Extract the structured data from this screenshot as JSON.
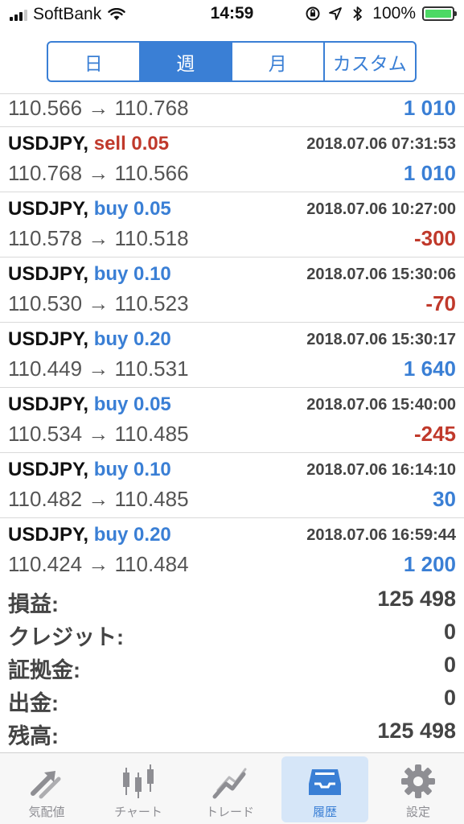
{
  "status_bar": {
    "carrier": "SoftBank",
    "time": "14:59",
    "battery": "100%",
    "battery_color": "#4cd964"
  },
  "segments": [
    {
      "label": "日",
      "active": false
    },
    {
      "label": "週",
      "active": true
    },
    {
      "label": "月",
      "active": false
    },
    {
      "label": "カスタム",
      "active": false
    }
  ],
  "partial_row": {
    "prices": "110.566 → 110.768",
    "pl": "1 010"
  },
  "trades": [
    {
      "symbol": "USDJPY,",
      "side": "sell",
      "lots": "sell 0.05",
      "datetime": "2018.07.06 07:31:53",
      "prices": "110.768 → 110.566",
      "pl": "1 010",
      "pl_sign": "pos"
    },
    {
      "symbol": "USDJPY,",
      "side": "buy",
      "lots": "buy 0.05",
      "datetime": "2018.07.06 10:27:00",
      "prices": "110.578 → 110.518",
      "pl": "-300",
      "pl_sign": "neg"
    },
    {
      "symbol": "USDJPY,",
      "side": "buy",
      "lots": "buy 0.10",
      "datetime": "2018.07.06 15:30:06",
      "prices": "110.530 → 110.523",
      "pl": "-70",
      "pl_sign": "neg"
    },
    {
      "symbol": "USDJPY,",
      "side": "buy",
      "lots": "buy 0.20",
      "datetime": "2018.07.06 15:30:17",
      "prices": "110.449 → 110.531",
      "pl": "1 640",
      "pl_sign": "pos"
    },
    {
      "symbol": "USDJPY,",
      "side": "buy",
      "lots": "buy 0.05",
      "datetime": "2018.07.06 15:40:00",
      "prices": "110.534 → 110.485",
      "pl": "-245",
      "pl_sign": "neg"
    },
    {
      "symbol": "USDJPY,",
      "side": "buy",
      "lots": "buy 0.10",
      "datetime": "2018.07.06 16:14:10",
      "prices": "110.482 → 110.485",
      "pl": "30",
      "pl_sign": "pos"
    },
    {
      "symbol": "USDJPY,",
      "side": "buy",
      "lots": "buy 0.20",
      "datetime": "2018.07.06 16:59:44",
      "prices": "110.424 → 110.484",
      "pl": "1 200",
      "pl_sign": "pos"
    }
  ],
  "summary": [
    {
      "label": "損益:",
      "value": "125 498"
    },
    {
      "label": "クレジット:",
      "value": "0"
    },
    {
      "label": "証拠金:",
      "value": "0"
    },
    {
      "label": "出金:",
      "value": "0"
    },
    {
      "label": "残高:",
      "value": "125 498"
    }
  ],
  "tabs": [
    {
      "label": "気配値",
      "icon": "quotes-arrows-icon",
      "active": false
    },
    {
      "label": "チャート",
      "icon": "candlestick-chart-icon",
      "active": false
    },
    {
      "label": "トレード",
      "icon": "trade-trend-icon",
      "active": false
    },
    {
      "label": "履歴",
      "icon": "history-inbox-icon",
      "active": true
    },
    {
      "label": "設定",
      "icon": "gear-icon",
      "active": false
    }
  ],
  "colors": {
    "accent": "#3a7fd5",
    "sell": "#c0392b",
    "negative": "#c0392b",
    "positive": "#3a7fd5"
  }
}
